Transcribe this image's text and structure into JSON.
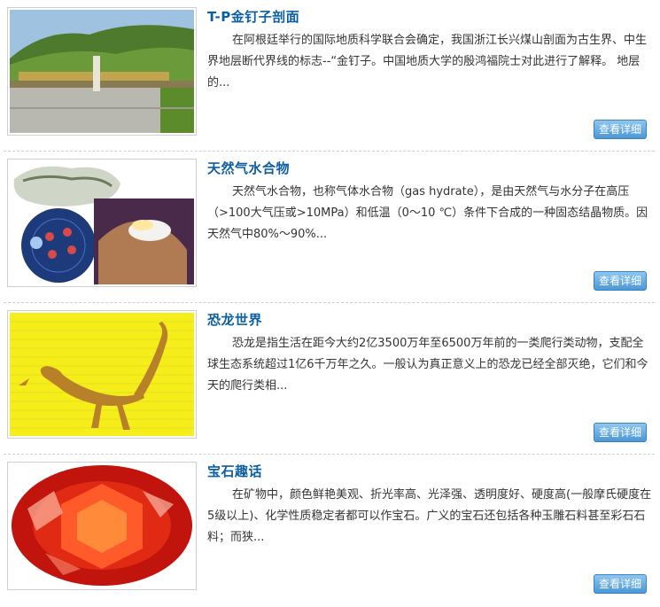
{
  "articles": [
    {
      "title": "T-P金钉子剖面",
      "description": "在阿根廷举行的国际地质科学联合会确定，我国浙江长兴煤山剖面为古生界、中生界地层断代界线的标志--“金钉子。中国地质大学的殷鸿福院士对此进行了解释。        地层的...",
      "button_label": "查看详细",
      "image": "golden-spike-monument-image"
    },
    {
      "title": "天然气水合物",
      "description": "天然气水合物，也称气体水合物（gas hydrate），是由天然气与水分子在高压（>100大气压或>10MPa）和低温（0～10 ℃）条件下合成的一种固态结晶物质。因天然气中80%～90%...",
      "button_label": "查看详细",
      "image": "gas-hydrate-image",
      "image_caption": "甲烷分子"
    },
    {
      "title": "恐龙世界",
      "description": "恐龙是指生活在距今大约2亿3500万年至6500万年前的一类爬行类动物，支配全球生态系统超过1亿6千万年之久。一般认为真正意义上的恐龙已经全部灭绝，它们和今天的爬行类相...",
      "button_label": "查看详细",
      "image": "dinosaur-skeleton-image"
    },
    {
      "title": "宝石趣话",
      "description": "在矿物中，颜色鲜艳美观、折光率高、光泽强、透明度好、硬度高(一般摩氏硬度在5级以上)、化学性质稳定者都可以作宝石。广义的宝石还包括各种玉雕石料甚至彩石石料；而狭...",
      "button_label": "查看详细",
      "image": "red-gemstone-image"
    }
  ]
}
